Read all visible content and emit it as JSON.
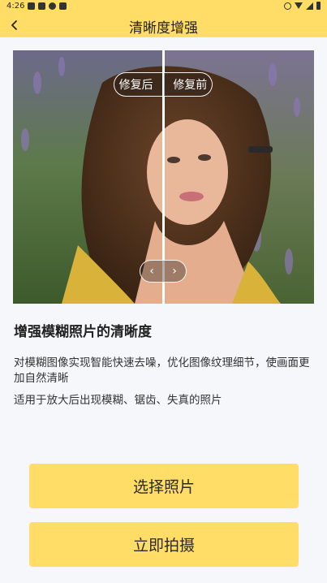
{
  "status_bar": {
    "time": "4:26"
  },
  "app_bar": {
    "title": "清晰度增强",
    "back_icon": "chevron-left-icon"
  },
  "comparison": {
    "after_label": "修复后",
    "before_label": "修复前",
    "handle_left_glyph": "‹",
    "handle_right_glyph": "›"
  },
  "feature": {
    "title": "增强模糊照片的清晰度",
    "description": "对模糊图像实现智能快速去噪，优化图像纹理细节，使画面更加自然清晰",
    "applicability": "适用于放大后出现模糊、锯齿、失真的照片"
  },
  "actions": {
    "select_photo": "选择照片",
    "take_photo": "立即拍摄"
  },
  "colors": {
    "accent": "#ffdd66",
    "background": "#f6f7fb"
  }
}
